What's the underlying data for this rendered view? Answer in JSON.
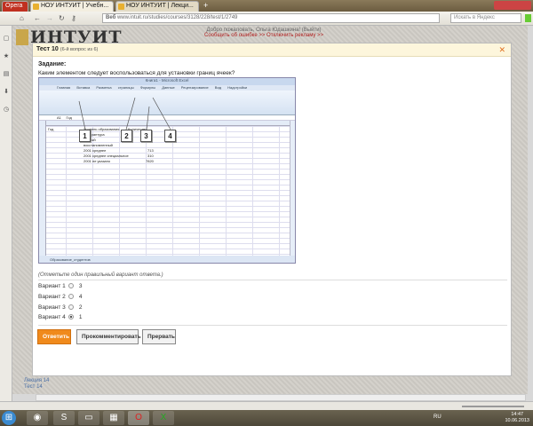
{
  "browser": {
    "menu_label": "Opera",
    "tabs": [
      {
        "label": "НОУ ИНТУИТ | Учебн...",
        "active": true
      },
      {
        "label": "НОУ ИНТУИТ | Лекци...",
        "active": false
      }
    ],
    "address_prefix": "Веб",
    "url": "www.intuit.ru/studies/courses/3128/228/test/1/2749",
    "search_placeholder": "Искать в Яндекс"
  },
  "site": {
    "logo": "ИНТУИТ",
    "welcome": "Добро пожаловать, Ольга Юдашкина! (Выйти)",
    "links": "Сообщить об ошибке >>   Отключить рекламу >>",
    "bottom_links": [
      "Лекция 14",
      "Тест 14"
    ]
  },
  "modal": {
    "title": "Тест 10",
    "subtitle": "(6-й вопрос из 6)",
    "task_label": "Задание:",
    "question": "Каким элементом следует воспользоваться для установки границ ячеек?",
    "instruction": "(Отметьте один правильный вариант ответа.)",
    "options": [
      {
        "label": "Вариант 1",
        "value": "3",
        "selected": false
      },
      {
        "label": "Вариант 2",
        "value": "4",
        "selected": false
      },
      {
        "label": "Вариант 3",
        "value": "2",
        "selected": false
      },
      {
        "label": "Вариант 4",
        "value": "1",
        "selected": true
      }
    ],
    "buttons": {
      "answer": "Ответить",
      "comment": "Прокомментировать",
      "abort": "Прервать"
    },
    "image": {
      "title": "Книга1 - Microsoft Excel",
      "tabs": "Главная Вставка Разметка страницы Формулы Данные Рецензирование Вид Надстройки",
      "cell_ref": "A1",
      "formula": "Год",
      "cells": [
        "Год",
        "Уровень образования",
        "Количество",
        "аспирантура",
        "ученый",
        "восстановленный",
        "2001 среднее",
        "2001 среднее специальное",
        "2001 не указано"
      ],
      "values": [
        "713",
        "310",
        "7820"
      ],
      "sheet_tabs": "Образование_студентов",
      "callouts": [
        "1",
        "2",
        "3",
        "4"
      ]
    }
  },
  "taskbar": {
    "lang": "RU",
    "time": "14:47",
    "date": "10.06.2013"
  },
  "colors": {
    "accent": "#f08a1c",
    "header_bg": "#fdf6dc",
    "link_red": "#b02020"
  }
}
